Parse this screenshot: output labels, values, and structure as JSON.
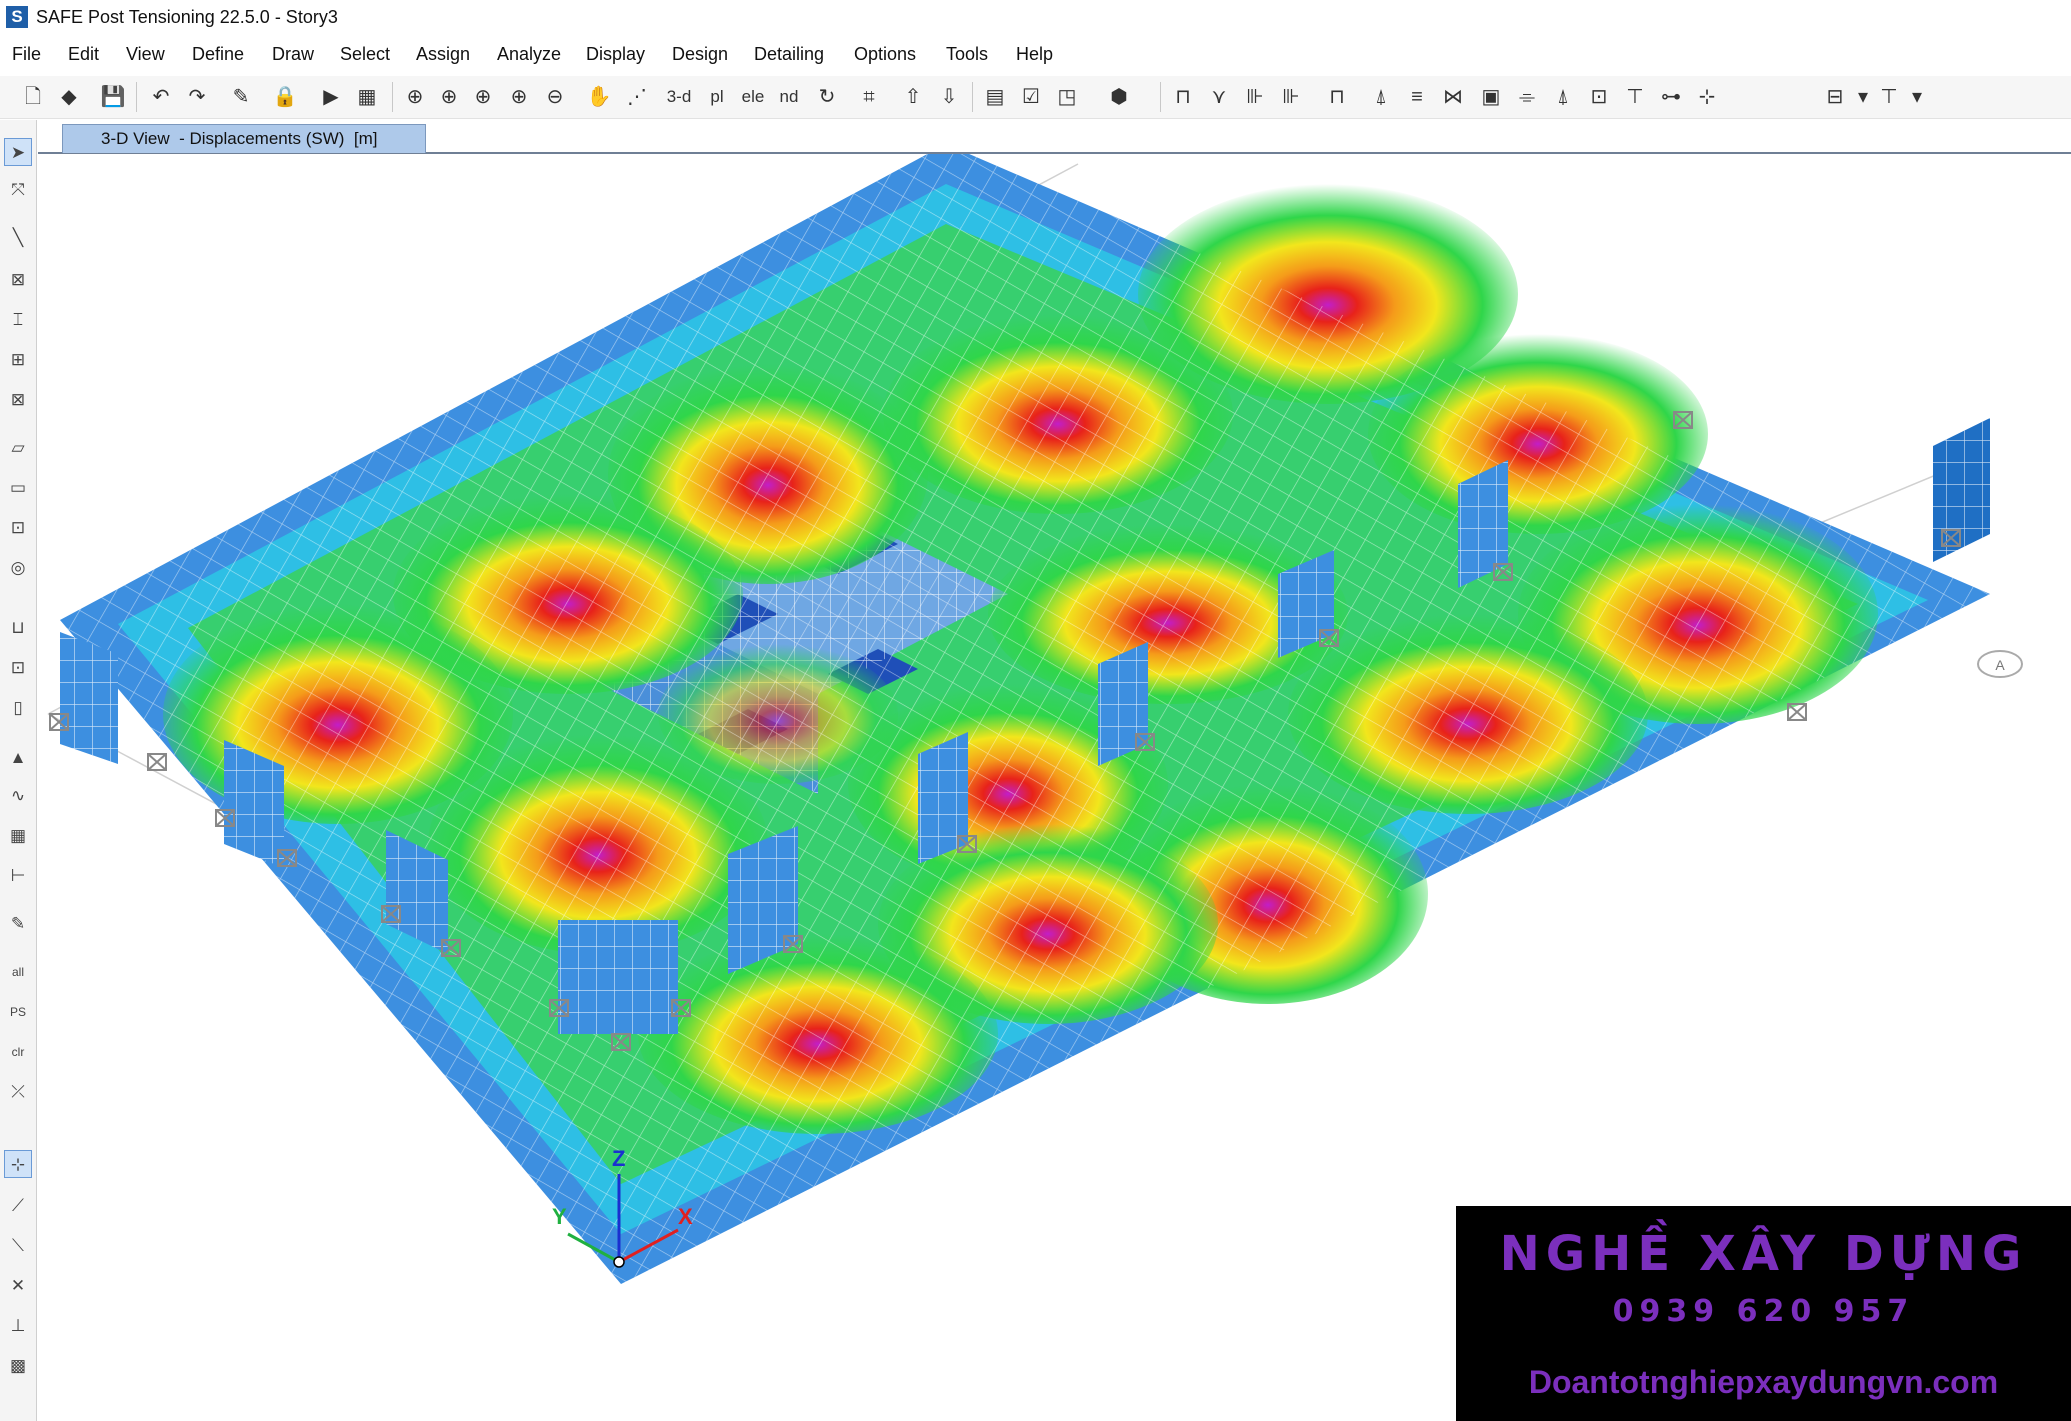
{
  "window": {
    "app_icon": "S",
    "title": "SAFE Post Tensioning 22.5.0 - Story3"
  },
  "menu": [
    "File",
    "Edit",
    "View",
    "Define",
    "Draw",
    "Select",
    "Assign",
    "Analyze",
    "Display",
    "Design",
    "Detailing",
    "Options",
    "Tools",
    "Help"
  ],
  "toolbar": {
    "view_3d": "3-d",
    "view_plan": "pl",
    "view_elev": "ele",
    "view_nd": "nd"
  },
  "left_toolbar": {
    "all": "all",
    "ps": "PS",
    "clr": "clr"
  },
  "view_tab": {
    "label": "3-D View  - Displacements (SW)  [m]"
  },
  "model": {
    "grid_bubble": "A",
    "axis_z": "Z",
    "axis_x": "X",
    "axis_y": "Y"
  },
  "colors": {
    "low": "#2e7fd6",
    "cyan": "#21d6e8",
    "green": "#2fd64a",
    "yellow": "#f2e61c",
    "orange": "#f59b1a",
    "red": "#e8221a",
    "peak": "#c21ec8"
  },
  "watermark": {
    "brand": "NGHỀ XÂY DỰNG",
    "phone": "0939 620 957",
    "website": "Doantotnghiepxaydungvn.com"
  }
}
